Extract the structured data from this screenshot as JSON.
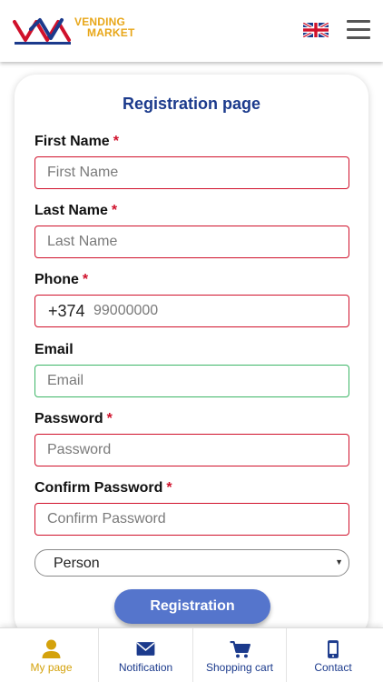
{
  "header": {
    "logo": {
      "line1": "VENDING",
      "line2": "MARKET"
    },
    "flag_icon": "uk-flag-icon",
    "menu_icon": "hamburger-menu-icon"
  },
  "form": {
    "title": "Registration page",
    "first_name": {
      "label": "First Name",
      "required": "*",
      "placeholder": "First Name"
    },
    "last_name": {
      "label": "Last Name",
      "required": "*",
      "placeholder": "Last Name"
    },
    "phone": {
      "label": "Phone",
      "required": "*",
      "code": "+374",
      "placeholder": "99000000"
    },
    "email": {
      "label": "Email",
      "placeholder": "Email"
    },
    "password": {
      "label": "Password",
      "required": "*",
      "placeholder": "Password"
    },
    "confirm_password": {
      "label": "Confirm Password",
      "required": "*",
      "placeholder": "Confirm Password"
    },
    "account_type": {
      "value": "Person"
    },
    "submit_label": "Registration"
  },
  "bottom_nav": [
    {
      "label": "My page",
      "icon": "user-icon",
      "active": true
    },
    {
      "label": "Notification",
      "icon": "envelope-icon",
      "active": false
    },
    {
      "label": "Shopping cart",
      "icon": "cart-icon",
      "active": false
    },
    {
      "label": "Contact",
      "icon": "phone-icon",
      "active": false
    }
  ],
  "colors": {
    "brand_blue": "#1b3a8c",
    "required_red": "#d0112b",
    "valid_green": "#3cb566",
    "button_blue": "#5575cc",
    "active_gold": "#d4a20c"
  }
}
